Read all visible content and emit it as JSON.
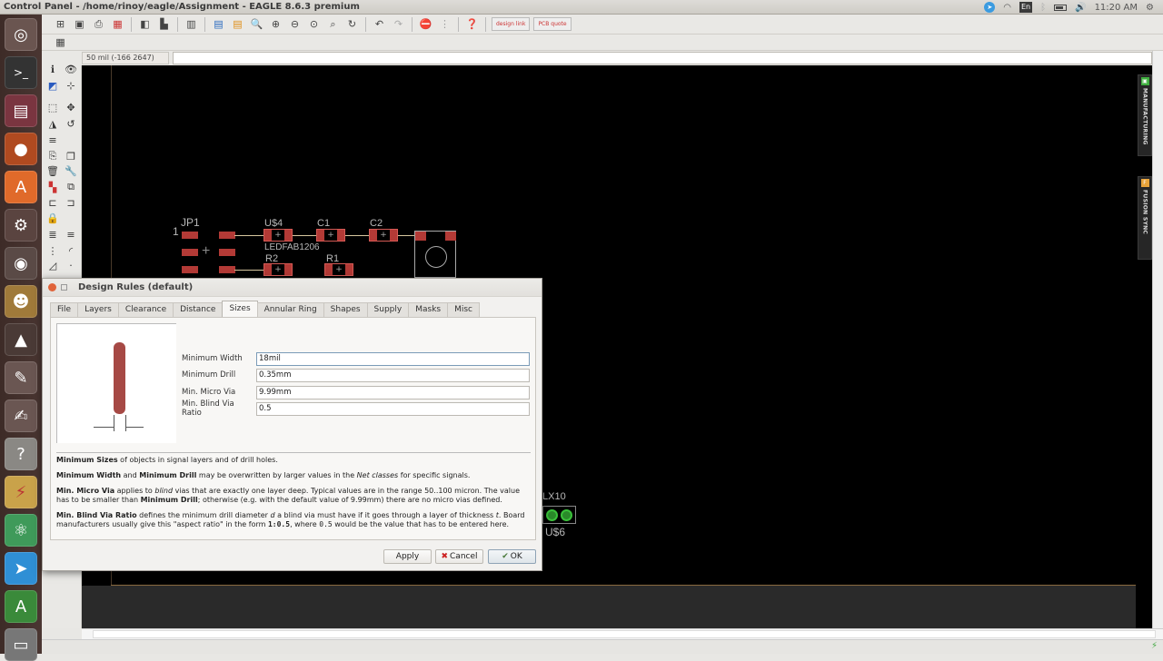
{
  "window_title": "Control Panel - /home/rinoy/eagle/Assignment - EAGLE 8.6.3 premium",
  "tray": {
    "clock": "11:20 AM",
    "keyboard_layout": "En"
  },
  "launcher": [
    "ubuntu-dash",
    "terminal",
    "files",
    "firefox",
    "software-center",
    "system-settings",
    "cheese-camera",
    "gimp",
    "inkscape",
    "mypaint",
    "text-editor",
    "help",
    "eagle-schematic",
    "atom",
    "telegram",
    "autodesk-eagle",
    "disk-drive"
  ],
  "toolbar": {
    "icons": [
      "open",
      "save",
      "print",
      "cam-processor",
      "switch-to-schematic",
      "layers",
      "cam",
      "bom",
      "script",
      "run-ulp",
      "zoom-fit",
      "zoom-in",
      "zoom-out",
      "zoom-select",
      "zoom-area",
      "redraw",
      "undo",
      "redo",
      "stop",
      "go",
      "help"
    ],
    "designlink_label": "design link",
    "pcbquote_label": "PCB quote"
  },
  "command_bar": {
    "coordinate": "50 mil (-166 2647)",
    "command_value": ""
  },
  "pcb": {
    "labels": [
      "JP1",
      "1",
      "U$4",
      "C1",
      "C2",
      "LEDFAB1206",
      "R2",
      "R1",
      "LX10",
      "U$6"
    ]
  },
  "side_tabs": [
    {
      "label": "MANUFACTURING",
      "color": "#3fae3f"
    },
    {
      "label": "FUSION SYNC",
      "color": "#e8a33a"
    }
  ],
  "dialog": {
    "title": "Design Rules (default)",
    "tabs": [
      "File",
      "Layers",
      "Clearance",
      "Distance",
      "Sizes",
      "Annular Ring",
      "Shapes",
      "Supply",
      "Masks",
      "Misc"
    ],
    "active_tab": "Sizes",
    "fields": [
      {
        "label": "Minimum Width",
        "value": "18mil"
      },
      {
        "label": "Minimum Drill",
        "value": "0.35mm"
      },
      {
        "label": "Min. Micro Via",
        "value": "9.99mm"
      },
      {
        "label": "Min. Blind Via Ratio",
        "value": "0.5"
      }
    ],
    "desc": {
      "p1_b": "Minimum Sizes",
      "p1": " of objects in signal layers and of drill holes.",
      "p2_b1": "Minimum Width",
      "p2_a": " and ",
      "p2_b2": "Minimum Drill",
      "p2_b": " may be overwritten by larger values in the ",
      "p2_i": "Net classes",
      "p2_c": " for specific signals.",
      "p3_b1": "Min. Micro Via",
      "p3_a": " applies to ",
      "p3_i": "blind",
      "p3_b": " vias that are exactly one layer deep. Typical values are in the range 50..100 micron. The value has to be smaller than ",
      "p3_b2": "Minimum Drill",
      "p3_c": "; otherwise (e.g. with the default value of 9.99mm) there are no micro vias defined.",
      "p4_b": "Min. Blind Via Ratio",
      "p4_a": " defines the minimum drill diameter ",
      "p4_i1": "d",
      "p4_b2": " a blind via must have if it goes through a layer of thickness ",
      "p4_i2": "t",
      "p4_c": ". Board manufacturers usually give this \"aspect ratio\" in the form ",
      "p4_code1": "1:0.5",
      "p4_d": ", where ",
      "p4_code2": "0.5",
      "p4_e": " would be the value that has to be entered here."
    },
    "buttons": {
      "apply": "Apply",
      "cancel": "Cancel",
      "ok": "OK"
    }
  }
}
